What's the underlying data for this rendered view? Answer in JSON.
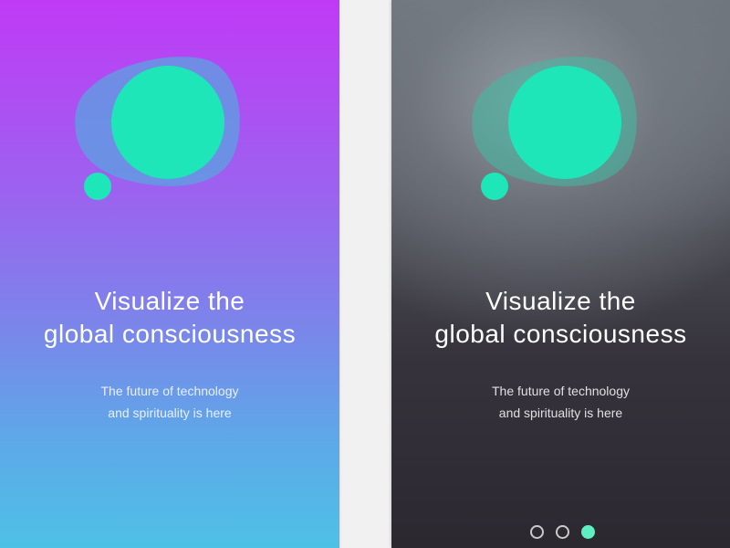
{
  "colors": {
    "accent": "#1fe6b8",
    "blob": "#5aa3e0",
    "left_gradient_top": "#c03af6",
    "left_gradient_bottom": "#4ec1e6",
    "right_bg": "#2b2830",
    "pager_active": "#5ef0c2"
  },
  "screens": [
    {
      "logo_icon": "thought-bubble-logo-icon",
      "headline": {
        "line1": "Visualize the",
        "line2": "global consciousness"
      },
      "subtext": {
        "line1": "The future of technology",
        "line2": "and spirituality is here"
      }
    },
    {
      "logo_icon": "thought-bubble-logo-icon",
      "headline": {
        "line1": "Visualize the",
        "line2": "global consciousness"
      },
      "subtext": {
        "line1": "The future of technology",
        "line2": "and spirituality is here"
      },
      "pager": {
        "total": 3,
        "active_index": 2
      }
    }
  ]
}
